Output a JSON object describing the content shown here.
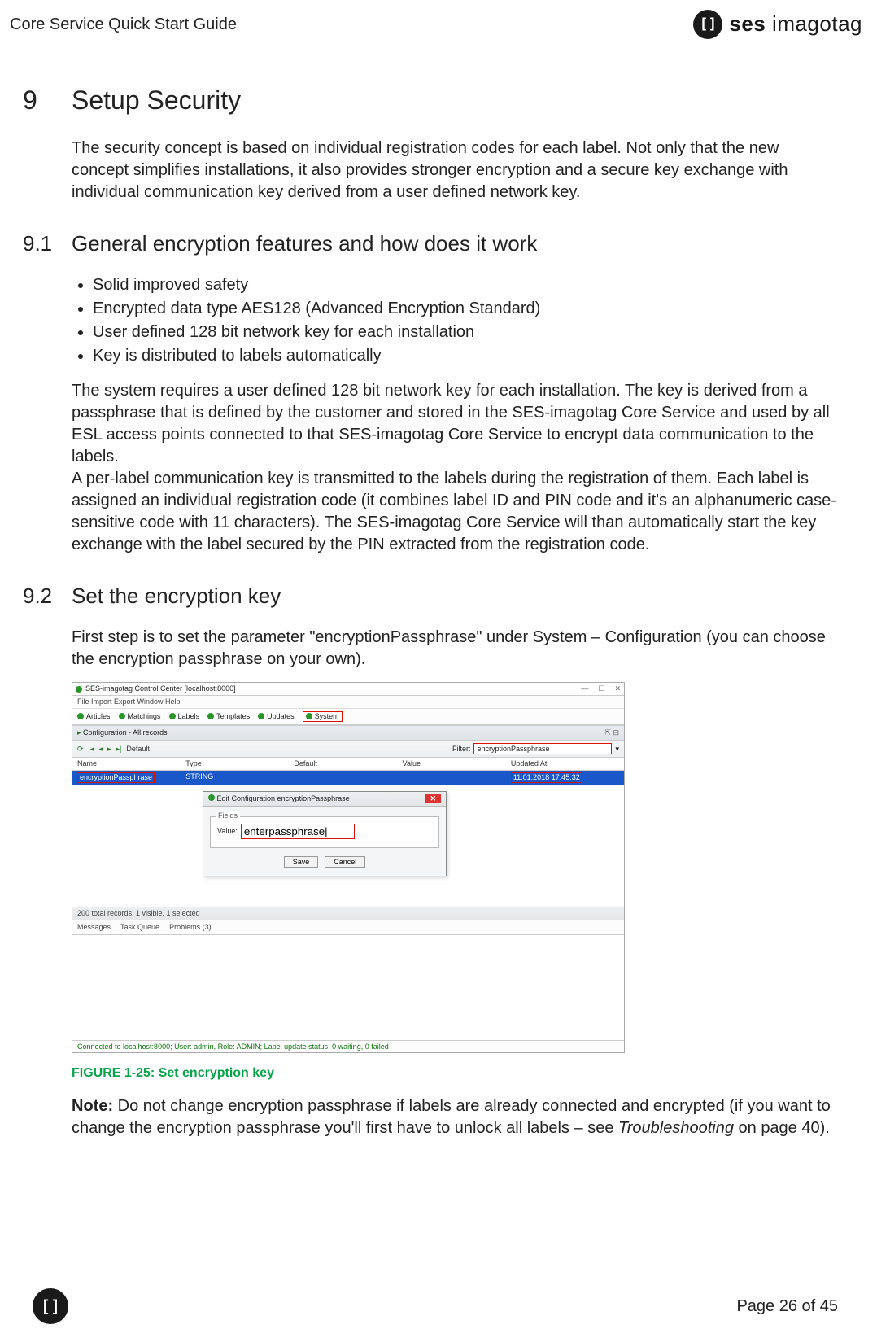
{
  "header": {
    "title": "Core Service Quick Start Guide",
    "brand_bold": "ses",
    "brand_light": " imagotag"
  },
  "h1": {
    "num": "9",
    "text": "Setup Security"
  },
  "intro": "The security concept is based on individual registration codes for each label. Not only that the new concept simplifies installations, it also provides stronger encryption and a secure key exchange with individual communication key derived from a user defined network key.",
  "h2_1": {
    "num": "9.1",
    "text": "General encryption features and how does it work"
  },
  "features": [
    "Solid improved safety",
    "Encrypted data type AES128 (Advanced Encryption Standard)",
    "User defined 128 bit network key for each installation",
    "Key is distributed to labels automatically"
  ],
  "para91": "The system requires a user defined 128 bit network key for each installation. The key is derived from a passphrase that is defined by the customer and stored in the SES-imagotag Core Service and used by all ESL access points connected to that SES-imagotag Core Service to encrypt data communication to the labels.\nA per-label communication key is transmitted to the labels during the registration of them. Each label is assigned an individual registration code (it combines label ID and PIN code and it's an alphanumeric case-sensitive code with 11 characters). The SES-imagotag Core Service will than automatically start the key exchange with the label secured by the PIN extracted from the registration code.",
  "h2_2": {
    "num": "9.2",
    "text": "Set the encryption key"
  },
  "para92": "First step is to set the parameter \"encryptionPassphrase\" under System – Configuration (you can choose the encryption passphrase on your own).",
  "fig": {
    "window_title": "SES-imagotag Control Center [localhost:8000]",
    "menubar": "File  Import  Export  Window  Help",
    "tabs": [
      "Articles",
      "Matchings",
      "Labels",
      "Templates",
      "Updates",
      "System"
    ],
    "panel_title": "Configuration - All records",
    "toolbar_default": "Default",
    "filter_label": "Filter:",
    "filter_value": "encryptionPassphrase",
    "thead": [
      "Name",
      "Type",
      "Default",
      "Value",
      "Updated At"
    ],
    "row": {
      "name": "encryptionPassphrase",
      "type": "STRING",
      "default": "",
      "value": "",
      "updated": "11.01.2018 17:45:32"
    },
    "dialog_title": "Edit Configuration encryptionPassphrase",
    "fields_label": "Fields",
    "value_label": "Value:",
    "value_input": "enterpassphrase|",
    "btn_save": "Save",
    "btn_cancel": "Cancel",
    "records_status": "200 total records, 1 visible, 1 selected",
    "lower_tabs": [
      "Messages",
      "Task Queue",
      "Problems (3)"
    ],
    "conn_status": "Connected to localhost:8000; User: admin, Role: ADMIN; Label update status: 0 waiting, 0 failed"
  },
  "figure_caption": "FIGURE 1-25: Set encryption key",
  "note_label": "Note:",
  "note_body_1": " Do not change encryption passphrase if labels are already connected and encrypted (if you want to change the encryption passphrase you'll first have to unlock all labels – see ",
  "note_italic": "Troubleshooting",
  "note_body_2": " on page 40).",
  "footer": {
    "page": "Page 26 of 45"
  }
}
